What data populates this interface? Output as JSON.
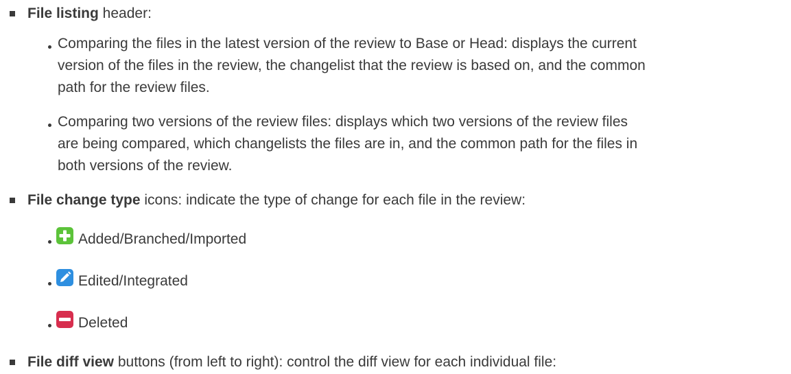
{
  "items": [
    {
      "bold": "File listing",
      "rest": " header:",
      "sub": [
        {
          "lines": [
            "Comparing the files in the latest version of the review to Base or Head: displays the current",
            "version of the files in the review, the changelist that the review is based on, and the common",
            "path for the review files."
          ]
        },
        {
          "lines": [
            "Comparing two versions of the review files: displays which two versions of the review files",
            "are being compared, which changelists the files are in, and the common path for the files in",
            "both versions of the review."
          ]
        }
      ]
    },
    {
      "bold": "File change type",
      "rest": " icons: indicate the type of change for each file in the review:",
      "icons": [
        {
          "icon": "plus-icon",
          "label": "Added/Branched/Imported",
          "color": "#5cc33a"
        },
        {
          "icon": "pencil-icon",
          "label": "Edited/Integrated",
          "color": "#2e8fe0"
        },
        {
          "icon": "minus-icon",
          "label": "Deleted",
          "color": "#d72e4e"
        }
      ]
    },
    {
      "bold": "File diff view",
      "rest": " buttons (from left to right): control the diff view for each individual file:"
    }
  ]
}
